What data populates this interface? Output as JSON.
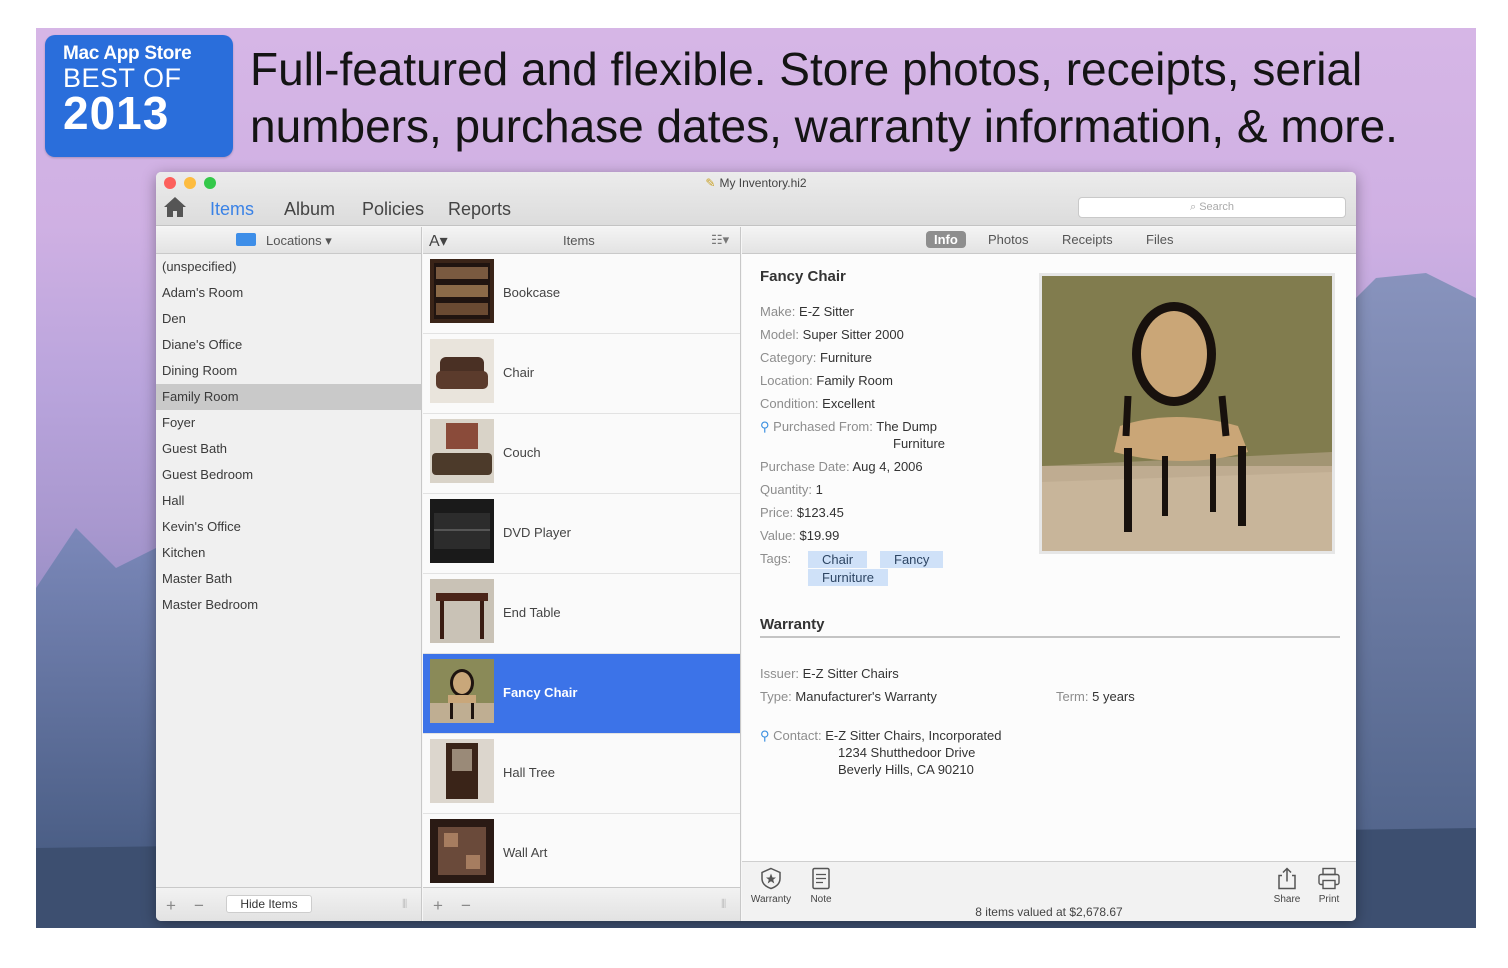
{
  "badge": {
    "line1": "Mac App Store",
    "line2": "BEST OF",
    "line3": "2013"
  },
  "headline": "Full-featured and flexible. Store photos, receipts, serial numbers, purchase dates, warranty information, & more.",
  "window": {
    "title": "My Inventory.hi2"
  },
  "nav": {
    "items": "Items",
    "album": "Album",
    "policies": "Policies",
    "reports": "Reports"
  },
  "search": {
    "placeholder": "Search"
  },
  "locations": {
    "header": "Locations ▾",
    "list": [
      "(unspecified)",
      "Adam's Room",
      "Den",
      "Diane's Office",
      "Dining Room",
      "Family Room",
      "Foyer",
      "Guest Bath",
      "Guest Bedroom",
      "Hall",
      "Kevin's Office",
      "Kitchen",
      "Master Bath",
      "Master Bedroom"
    ],
    "selected": "Family Room"
  },
  "items": {
    "sort_label": "A▾",
    "header": "Items",
    "list": [
      "Bookcase",
      "Chair",
      "Couch",
      "DVD Player",
      "End Table",
      "Fancy Chair",
      "Hall Tree",
      "Wall Art"
    ],
    "selected": "Fancy Chair"
  },
  "detail_tabs": {
    "info": "Info",
    "photos": "Photos",
    "receipts": "Receipts",
    "files": "Files"
  },
  "detail": {
    "title": "Fancy Chair",
    "make_label": "Make:",
    "make": "E-Z Sitter",
    "model_label": "Model:",
    "model": "Super Sitter 2000",
    "category_label": "Category:",
    "category": "Furniture",
    "location_label": "Location:",
    "location": "Family Room",
    "condition_label": "Condition:",
    "condition": "Excellent",
    "purchased_from_label": "Purchased From:",
    "purchased_from_1": "The Dump",
    "purchased_from_2": "Furniture",
    "purchase_date_label": "Purchase Date:",
    "purchase_date": "Aug 4, 2006",
    "quantity_label": "Quantity:",
    "quantity": "1",
    "price_label": "Price:",
    "price": "$123.45",
    "value_label": "Value:",
    "value": "$19.99",
    "tags_label": "Tags:",
    "tags": [
      "Chair",
      "Fancy",
      "Furniture"
    ]
  },
  "warranty": {
    "heading": "Warranty",
    "issuer_label": "Issuer:",
    "issuer": "E-Z Sitter Chairs",
    "type_label": "Type:",
    "type": "Manufacturer's Warranty",
    "term_label": "Term:",
    "term": "5 years",
    "contact_label": "Contact:",
    "contact_1": "E-Z Sitter Chairs, Incorporated",
    "contact_2": "1234 Shutthedoor Drive",
    "contact_3": "Beverly Hills, CA 90210"
  },
  "toolbar": {
    "warranty": "Warranty",
    "note": "Note",
    "share": "Share",
    "print": "Print"
  },
  "bottom": {
    "plus": "+",
    "minus": "−",
    "hide_items": "Hide Items",
    "status": "8 items valued at $2,678.67"
  },
  "colors": {
    "accent": "#3a82e6",
    "selection": "#3c73e8",
    "tag": "#cfe1f8",
    "badge": "#2a6edb"
  },
  "icons": [
    "home-icon",
    "locations-icon",
    "view-options-icon",
    "search-icon",
    "location-pin-icon",
    "warranty-icon",
    "note-icon",
    "share-icon",
    "print-icon"
  ]
}
